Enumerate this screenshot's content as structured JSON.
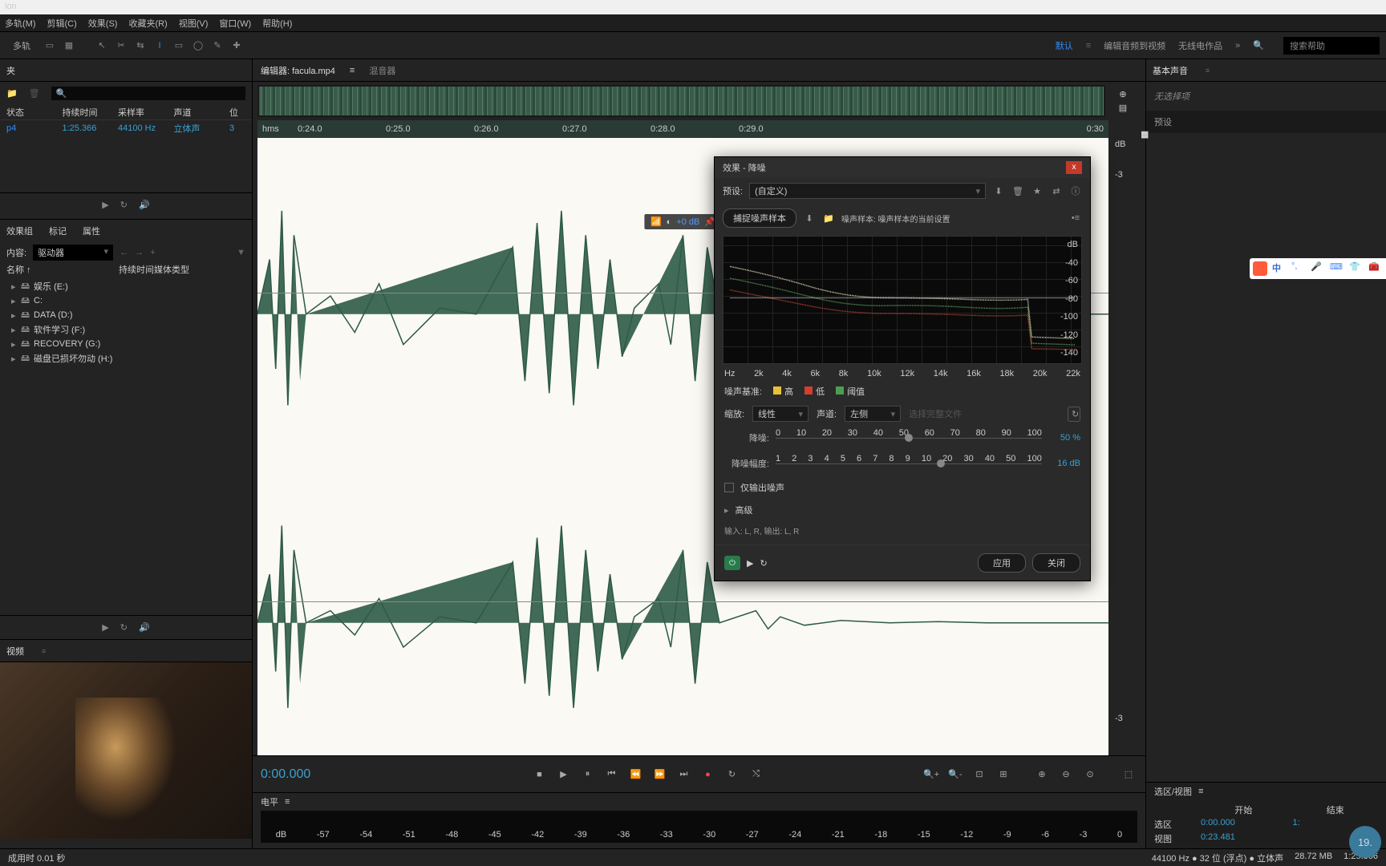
{
  "app_title": "ion",
  "menu": [
    "多轨(M)",
    "剪辑(C)",
    "效果(S)",
    "收藏夹(R)",
    "视图(V)",
    "窗口(W)",
    "帮助(H)"
  ],
  "toolbar": {
    "mode_multitrack": "多轨",
    "workspaces": [
      "默认",
      "编辑音频到视频",
      "无线电作品"
    ],
    "search_placeholder": "搜索帮助"
  },
  "files_panel": {
    "title": "夹",
    "cols": [
      "状态",
      "持续时间",
      "采样率",
      "声道",
      "位"
    ],
    "row": {
      "name": "p4",
      "duration": "1:25.366",
      "rate": "44100 Hz",
      "channels": "立体声",
      "bits": "3"
    }
  },
  "media_panel": {
    "tabs": [
      "效果组",
      "标记",
      "属性"
    ],
    "content_label": "内容:",
    "content_value": "驱动器",
    "cols": [
      "名称 ↑",
      "持续时间",
      "媒体类型"
    ],
    "tree": [
      {
        "label": "娱乐 (E:)"
      },
      {
        "label": "C:"
      },
      {
        "label": "DATA (D:)"
      },
      {
        "label": "软件学习 (F:)"
      },
      {
        "label": "RECOVERY (G:)"
      },
      {
        "label": "磁盘已损坏勿动 (H:)"
      }
    ],
    "left_labels": [
      "A (D:",
      "E (E:",
      "学习",
      "OVER",
      "已损"
    ]
  },
  "video_panel": {
    "title": "视频"
  },
  "editor": {
    "tab": "编辑器: facula.mp4",
    "tab2": "混音器",
    "hms": "hms",
    "ruler": [
      "0:24.0",
      "0:25.0",
      "0:26.0",
      "0:27.0",
      "0:28.0",
      "0:29.0",
      "0:30"
    ],
    "hud_val": "+0 dB",
    "db_label": "dB",
    "db_ticks": [
      "-3",
      "-3"
    ],
    "time": "0:00.000"
  },
  "levels": {
    "title": "电平",
    "scale": [
      "dB",
      "-57",
      "-54",
      "-51",
      "-48",
      "-45",
      "-42",
      "-39",
      "-36",
      "-33",
      "-30",
      "-27",
      "-24",
      "-21",
      "-18",
      "-15",
      "-12",
      "-9",
      "-6",
      "-3",
      "0"
    ]
  },
  "right_panel": {
    "title": "基本声音",
    "no_selection": "无选择项",
    "preset": "预设"
  },
  "dialog": {
    "title": "效果 - 降噪",
    "preset_label": "预设:",
    "preset_value": "(自定义)",
    "capture_btn": "捕捉噪声样本",
    "noise_sample_label": "噪声样本: 噪声样本的当前设置",
    "freq_scale": [
      "Hz",
      "2k",
      "4k",
      "6k",
      "8k",
      "10k",
      "12k",
      "14k",
      "16k",
      "18k",
      "20k",
      "22k"
    ],
    "db_scale": [
      "dB",
      "-40",
      "-60",
      "-80",
      "-100",
      "-120",
      "-140"
    ],
    "noise_floor_label": "噪声基准:",
    "legend": [
      {
        "color": "#e8c038",
        "label": "高"
      },
      {
        "color": "#d04030",
        "label": "低"
      },
      {
        "color": "#4aa050",
        "label": "阈值"
      }
    ],
    "scale_label": "缩放:",
    "scale_value": "线性",
    "channel_label": "声道:",
    "channel_value": "左侧",
    "select_all": "选择完整文件",
    "nr_label": "降噪:",
    "nr_value": "50 %",
    "nr_ticks": [
      "0",
      "10",
      "20",
      "30",
      "40",
      "50",
      "60",
      "70",
      "80",
      "90",
      "100"
    ],
    "nrby_label": "降噪幅度:",
    "nrby_value": "16 dB",
    "nrby_ticks": [
      "1",
      "2",
      "3",
      "4",
      "5",
      "6",
      "7",
      "8",
      "9",
      "10",
      "20",
      "30",
      "40",
      "50",
      "100"
    ],
    "output_noise": "仅输出噪声",
    "advanced": "高级",
    "io": "输入: L, R,  输出: L, R",
    "apply_btn": "应用",
    "close_btn": "关闭"
  },
  "selection": {
    "title": "选区/视图",
    "start": "开始",
    "end": "结束",
    "sel_label": "选区",
    "sel_start": "0:00.000",
    "sel_end": "1:",
    "view_label": "视图",
    "view_start": "0:23.481"
  },
  "status": {
    "left": "成用时 0.01 秒",
    "items": [
      "44100 Hz ● 32 位 (浮点) ● 立体声",
      "28.72 MB",
      "1:25.366"
    ]
  },
  "ime": {
    "char": "中"
  },
  "badge": "19."
}
